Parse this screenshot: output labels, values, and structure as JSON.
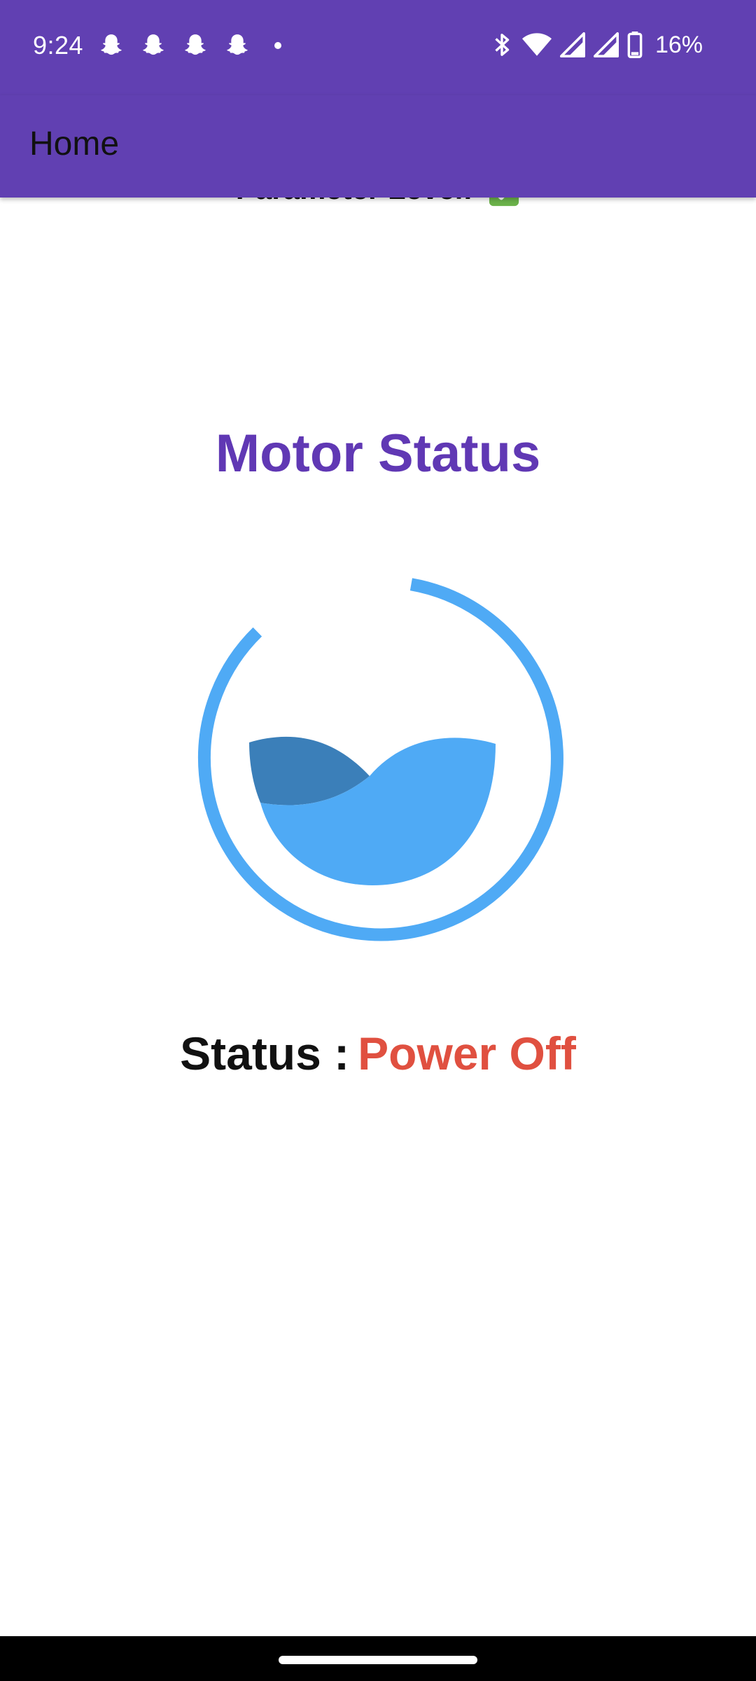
{
  "status_bar": {
    "time": "9:24",
    "notification_icons": [
      "snapchat-icon",
      "snapchat-icon",
      "snapchat-icon",
      "snapchat-icon"
    ],
    "battery": "16%"
  },
  "app_bar": {
    "title": "Home"
  },
  "content": {
    "scrolled_label": "Parameter Level:",
    "motor_title": "Motor Status",
    "status_label": "Status :",
    "status_value": "Power Off"
  },
  "colors": {
    "primary": "#6140b2",
    "title": "#6038b4",
    "status_off": "#e05040",
    "water_light": "#4faaf5",
    "water_dark": "#3b7fb9"
  }
}
